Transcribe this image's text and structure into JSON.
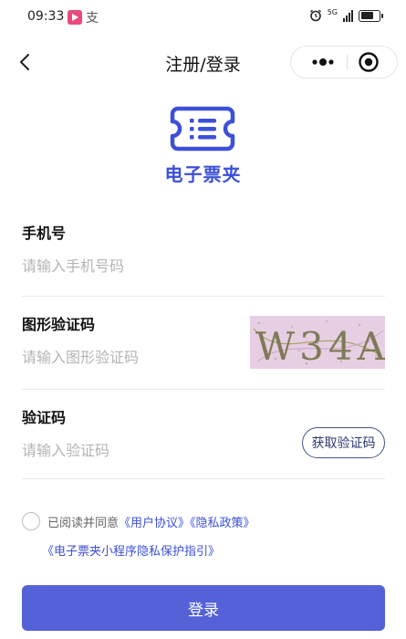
{
  "status_bar": {
    "time": "09:33",
    "app_icon": "video-app-icon",
    "alipay_icon_text": "支",
    "network": "5G",
    "icons": [
      "alarm-icon",
      "signal-icon",
      "battery-icon"
    ]
  },
  "nav": {
    "title": "注册/登录",
    "back_icon": "chevron-left-icon",
    "more_icon": "more-dots-icon",
    "close_icon": "target-close-icon"
  },
  "brand": {
    "name": "电子票夹",
    "logo_icon": "ticket-logo-icon",
    "color": "#3c50d8"
  },
  "form": {
    "phone": {
      "label": "手机号",
      "placeholder": "请输入手机号码",
      "value": ""
    },
    "captcha": {
      "label": "图形验证码",
      "placeholder": "请输入图形验证码",
      "value": "",
      "image_text": "W34A"
    },
    "sms_code": {
      "label": "验证码",
      "placeholder": "请输入验证码",
      "value": "",
      "button_label": "获取验证码"
    }
  },
  "agreement": {
    "checked": false,
    "prefix": "已阅读并同意",
    "links": [
      "《用户协议》",
      "《隐私政策》",
      "《电子票夹小程序隐私保护指引》"
    ]
  },
  "login_button": {
    "label": "登录",
    "color": "#5561d6"
  }
}
